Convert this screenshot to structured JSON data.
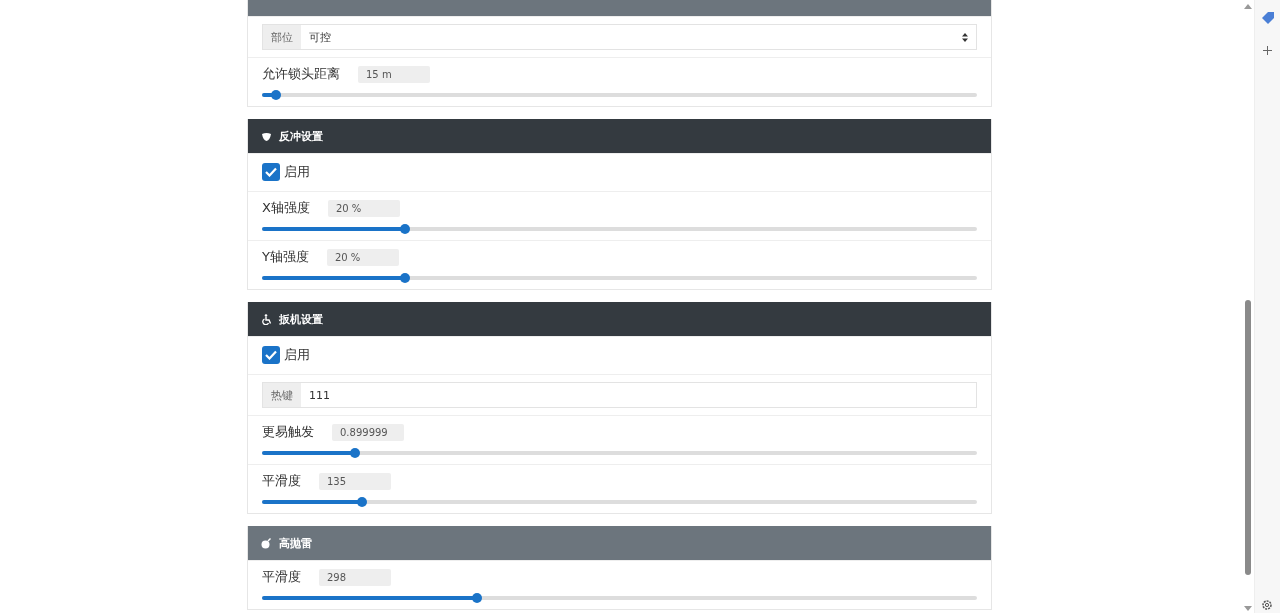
{
  "sections": [
    {
      "kind": "gray",
      "rows": [
        {
          "kind": "select",
          "addon": "部位",
          "value": "可控"
        },
        {
          "kind": "slider",
          "label": "允许锁头距离",
          "reading": "15 m",
          "level": 0.02
        }
      ]
    },
    {
      "kind": "dark",
      "title": "反冲设置",
      "rows": [
        {
          "kind": "checkbox",
          "label": "启用",
          "checked": true
        },
        {
          "kind": "slider",
          "label": "X轴强度",
          "reading": "20 %",
          "level": 0.2
        },
        {
          "kind": "slider",
          "label": "Y轴强度",
          "reading": "20 %",
          "level": 0.2
        }
      ]
    },
    {
      "kind": "dark",
      "title": "扳机设置",
      "rows": [
        {
          "kind": "checkbox",
          "label": "启用",
          "checked": true
        },
        {
          "kind": "input",
          "addon": "热键",
          "value": "111"
        },
        {
          "kind": "slider",
          "label": "更易触发",
          "reading": "0.899999",
          "level": 0.13
        },
        {
          "kind": "slider",
          "label": "平滑度",
          "reading": "135",
          "level": 0.14
        }
      ]
    },
    {
      "kind": "gray",
      "title": "高抛雷",
      "rows": [
        {
          "kind": "slider",
          "label": "平滑度",
          "reading": "298",
          "level": 0.3
        }
      ]
    }
  ]
}
